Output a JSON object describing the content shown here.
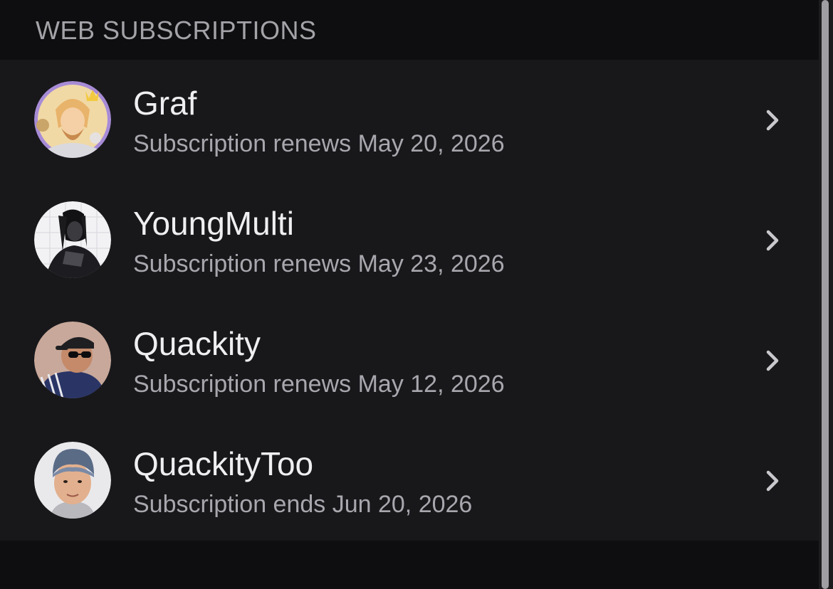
{
  "section": {
    "title": "WEB SUBSCRIPTIONS"
  },
  "subscriptions": [
    {
      "name": "Graf",
      "status": "Subscription renews May 20, 2026",
      "avatar": "graf-avatar"
    },
    {
      "name": "YoungMulti",
      "status": "Subscription renews May 23, 2026",
      "avatar": "youngmulti-avatar"
    },
    {
      "name": "Quackity",
      "status": "Subscription renews May 12, 2026",
      "avatar": "quackity-avatar"
    },
    {
      "name": "QuackityToo",
      "status": "Subscription ends Jun 20, 2026",
      "avatar": "quackitytoo-avatar"
    }
  ],
  "icons": {
    "row_action": "chevron-right-icon"
  },
  "colors": {
    "background": "#0e0e10",
    "list_background": "#18181b",
    "primary_text": "#efeff1",
    "secondary_text": "#a7a7ad"
  }
}
